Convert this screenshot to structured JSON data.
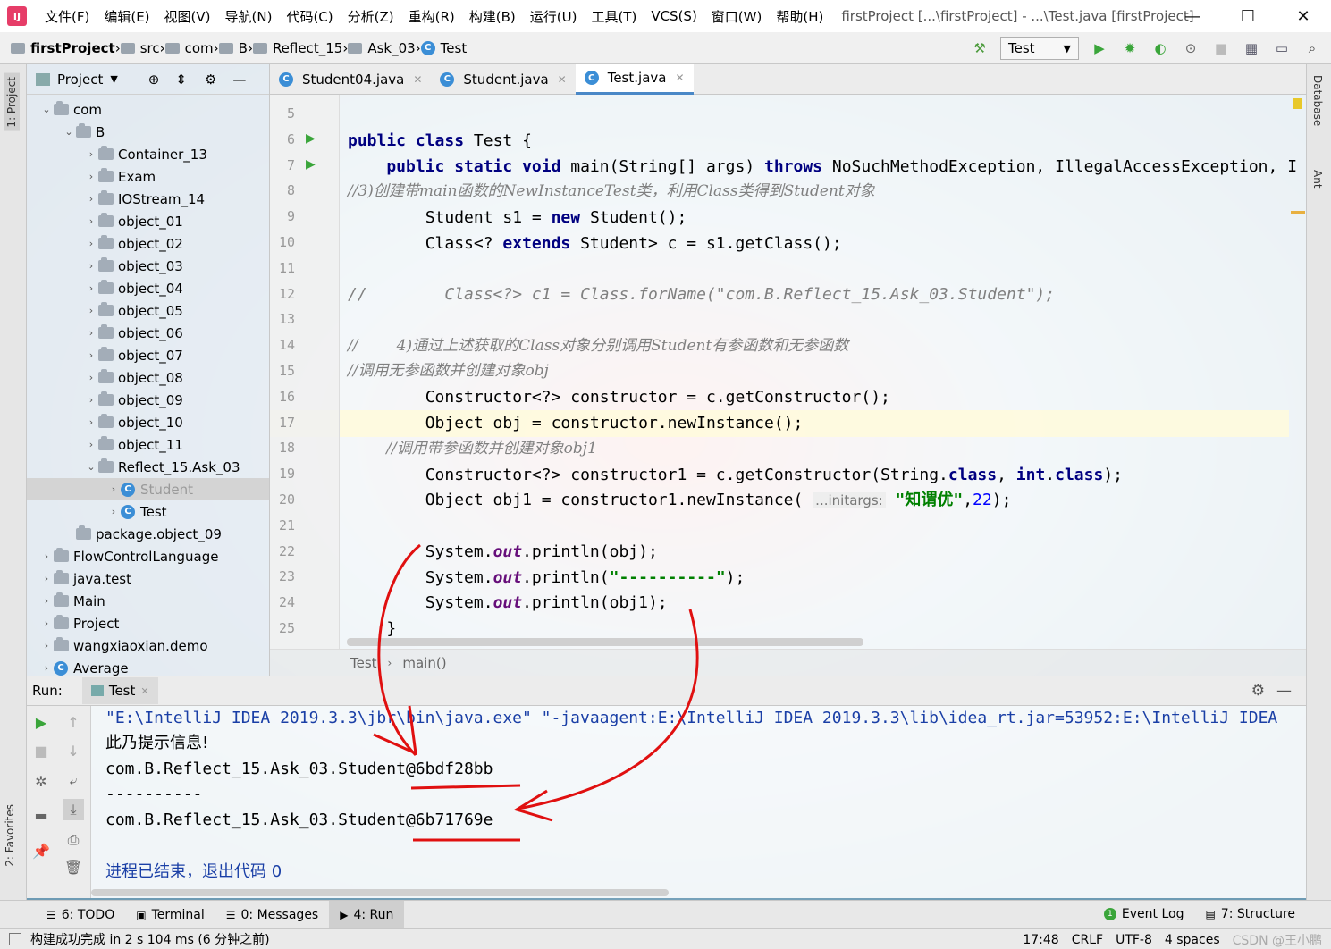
{
  "titlebar": {
    "menus": [
      "文件(F)",
      "编辑(E)",
      "视图(V)",
      "导航(N)",
      "代码(C)",
      "分析(Z)",
      "重构(R)",
      "构建(B)",
      "运行(U)",
      "工具(T)",
      "VCS(S)",
      "窗口(W)",
      "帮助(H)"
    ],
    "window_title": "firstProject [...\\firstProject] - ...\\Test.java [firstProject]"
  },
  "breadcrumbs": [
    "firstProject",
    "src",
    "com",
    "B",
    "Reflect_15",
    "Ask_03",
    "Test"
  ],
  "run_config": "Test",
  "project_panel": {
    "title": "Project",
    "tree": [
      {
        "label": "com",
        "depth": 0,
        "arrow": "down",
        "kind": "folder"
      },
      {
        "label": "B",
        "depth": 1,
        "arrow": "down",
        "kind": "folder"
      },
      {
        "label": "Container_13",
        "depth": 2,
        "arrow": "right",
        "kind": "folder"
      },
      {
        "label": "Exam",
        "depth": 2,
        "arrow": "right",
        "kind": "folder"
      },
      {
        "label": "IOStream_14",
        "depth": 2,
        "arrow": "right",
        "kind": "folder"
      },
      {
        "label": "object_01",
        "depth": 2,
        "arrow": "right",
        "kind": "folder"
      },
      {
        "label": "object_02",
        "depth": 2,
        "arrow": "right",
        "kind": "folder"
      },
      {
        "label": "object_03",
        "depth": 2,
        "arrow": "right",
        "kind": "folder"
      },
      {
        "label": "object_04",
        "depth": 2,
        "arrow": "right",
        "kind": "folder"
      },
      {
        "label": "object_05",
        "depth": 2,
        "arrow": "right",
        "kind": "folder"
      },
      {
        "label": "object_06",
        "depth": 2,
        "arrow": "right",
        "kind": "folder"
      },
      {
        "label": "object_07",
        "depth": 2,
        "arrow": "right",
        "kind": "folder"
      },
      {
        "label": "object_08",
        "depth": 2,
        "arrow": "right",
        "kind": "folder"
      },
      {
        "label": "object_09",
        "depth": 2,
        "arrow": "right",
        "kind": "folder"
      },
      {
        "label": "object_10",
        "depth": 2,
        "arrow": "right",
        "kind": "folder"
      },
      {
        "label": "object_11",
        "depth": 2,
        "arrow": "right",
        "kind": "folder"
      },
      {
        "label": "Reflect_15.Ask_03",
        "depth": 2,
        "arrow": "down",
        "kind": "folder"
      },
      {
        "label": "Student",
        "depth": 3,
        "arrow": "right",
        "kind": "class",
        "selected": true
      },
      {
        "label": "Test",
        "depth": 3,
        "arrow": "right",
        "kind": "class"
      },
      {
        "label": "package.object_09",
        "depth": 1,
        "arrow": "",
        "kind": "folder"
      },
      {
        "label": "FlowControlLanguage",
        "depth": 0,
        "arrow": "right",
        "kind": "folder"
      },
      {
        "label": "java.test",
        "depth": 0,
        "arrow": "right",
        "kind": "folder"
      },
      {
        "label": "Main",
        "depth": 0,
        "arrow": "right",
        "kind": "folder"
      },
      {
        "label": "Project",
        "depth": 0,
        "arrow": "right",
        "kind": "folder"
      },
      {
        "label": "wangxiaoxian.demo",
        "depth": 0,
        "arrow": "right",
        "kind": "folder"
      },
      {
        "label": "Average",
        "depth": 0,
        "arrow": "right",
        "kind": "class"
      }
    ]
  },
  "editor_tabs": [
    {
      "label": "Student04.java",
      "active": false
    },
    {
      "label": "Student.java",
      "active": false
    },
    {
      "label": "Test.java",
      "active": true
    }
  ],
  "editor": {
    "line_numbers": [
      "5",
      "6",
      "7",
      "8",
      "9",
      "10",
      "11",
      "12",
      "13",
      "14",
      "15",
      "16",
      "17",
      "18",
      "19",
      "20",
      "21",
      "22",
      "23",
      "24",
      "25"
    ],
    "code": {
      "l6_kw": "public class ",
      "l6_rest": "Test {",
      "l7_kw": "    public static void ",
      "l7_a": "main(String[] args) ",
      "l7_kw2": "throws ",
      "l7_b": "NoSuchMethodException, IllegalAccessException, I",
      "l8": "//3)创建带main函数的NewInstanceTest类，利用Class类得到Student对象",
      "l9_a": "        Student s1 = ",
      "l9_kw": "new ",
      "l9_b": "Student();",
      "l10_a": "        Class<? ",
      "l10_kw": "extends ",
      "l10_b": "Student> c = s1.getClass();",
      "l12": "//        Class<?> c1 = Class.forName(\"com.B.Reflect_15.Ask_03.Student\");",
      "l14": "//        4)通过上述获取的Class对象分别调用Student有参函数和无参函数",
      "l15": "//调用无参函数并创建对象obj",
      "l16": "        Constructor<?> constructor = c.getConstructor();",
      "l17": "        Object obj = constructor.newInstance();",
      "l18": "        //调用带参函数并创建对象obj1",
      "l19_a": "        Constructor<?> constructor1 = c.getConstructor(String.",
      "l19_kw1": "class",
      "l19_b": ", ",
      "l19_kw2": "int",
      "l19_c": ".",
      "l19_kw3": "class",
      "l19_d": ");",
      "l20_a": "        Object obj1 = constructor1.newInstance( ",
      "l20_hint": "...initargs:",
      "l20_str": " \"知谓优\"",
      "l20_b": ",",
      "l20_num": "22",
      "l20_c": ");",
      "l22_a": "        System.",
      "l22_f": "out",
      "l22_b": ".println(obj);",
      "l23_a": "        System.",
      "l23_f": "out",
      "l23_b": ".println(",
      "l23_str": "\"----------\"",
      "l23_c": ");",
      "l24_a": "        System.",
      "l24_f": "out",
      "l24_b": ".println(obj1);",
      "l25": "    }"
    },
    "crumbs": [
      "Test",
      "main()"
    ]
  },
  "run_panel": {
    "label": "Run:",
    "tab": "Test",
    "console": [
      {
        "text": "\"E:\\IntelliJ IDEA 2019.3.3\\jbr\\bin\\java.exe\" \"-javaagent:E:\\IntelliJ IDEA 2019.3.3\\lib\\idea_rt.jar=53952:E:\\IntelliJ IDEA",
        "color": "#1a3fa6"
      },
      {
        "text": "此乃提示信息!",
        "color": "#000000"
      },
      {
        "text": "com.B.Reflect_15.Ask_03.Student@6bdf28bb",
        "color": "#000000"
      },
      {
        "text": "----------",
        "color": "#000000"
      },
      {
        "text": "com.B.Reflect_15.Ask_03.Student@6b71769e",
        "color": "#000000"
      },
      {
        "text": "进程已结束，退出代码 0",
        "color": "#1a3fa6"
      }
    ]
  },
  "bottom_tabs": [
    {
      "label": "6: TODO",
      "active": false
    },
    {
      "label": "Terminal",
      "active": false
    },
    {
      "label": "0: Messages",
      "active": false
    },
    {
      "label": "4: Run",
      "active": true
    }
  ],
  "bottom_right_tabs": [
    "Event Log",
    "7: Structure"
  ],
  "left_strip": [
    "1: Project",
    "2: Favorites"
  ],
  "right_strip": [
    "Database",
    "Ant"
  ],
  "status": {
    "message": "构建成功完成 in 2 s 104 ms (6 分钟之前)",
    "position": "17:48",
    "line_sep": "CRLF",
    "encoding": "UTF-8",
    "indent": "4 spaces",
    "watermark": "CSDN @王小鹏"
  },
  "colors": {
    "keyword": "#000080",
    "comment": "#808080",
    "string": "#008000",
    "number": "#0000ff",
    "field": "#660e7a",
    "annotation_ink": "#e01010",
    "accent": "#4a88c7"
  }
}
